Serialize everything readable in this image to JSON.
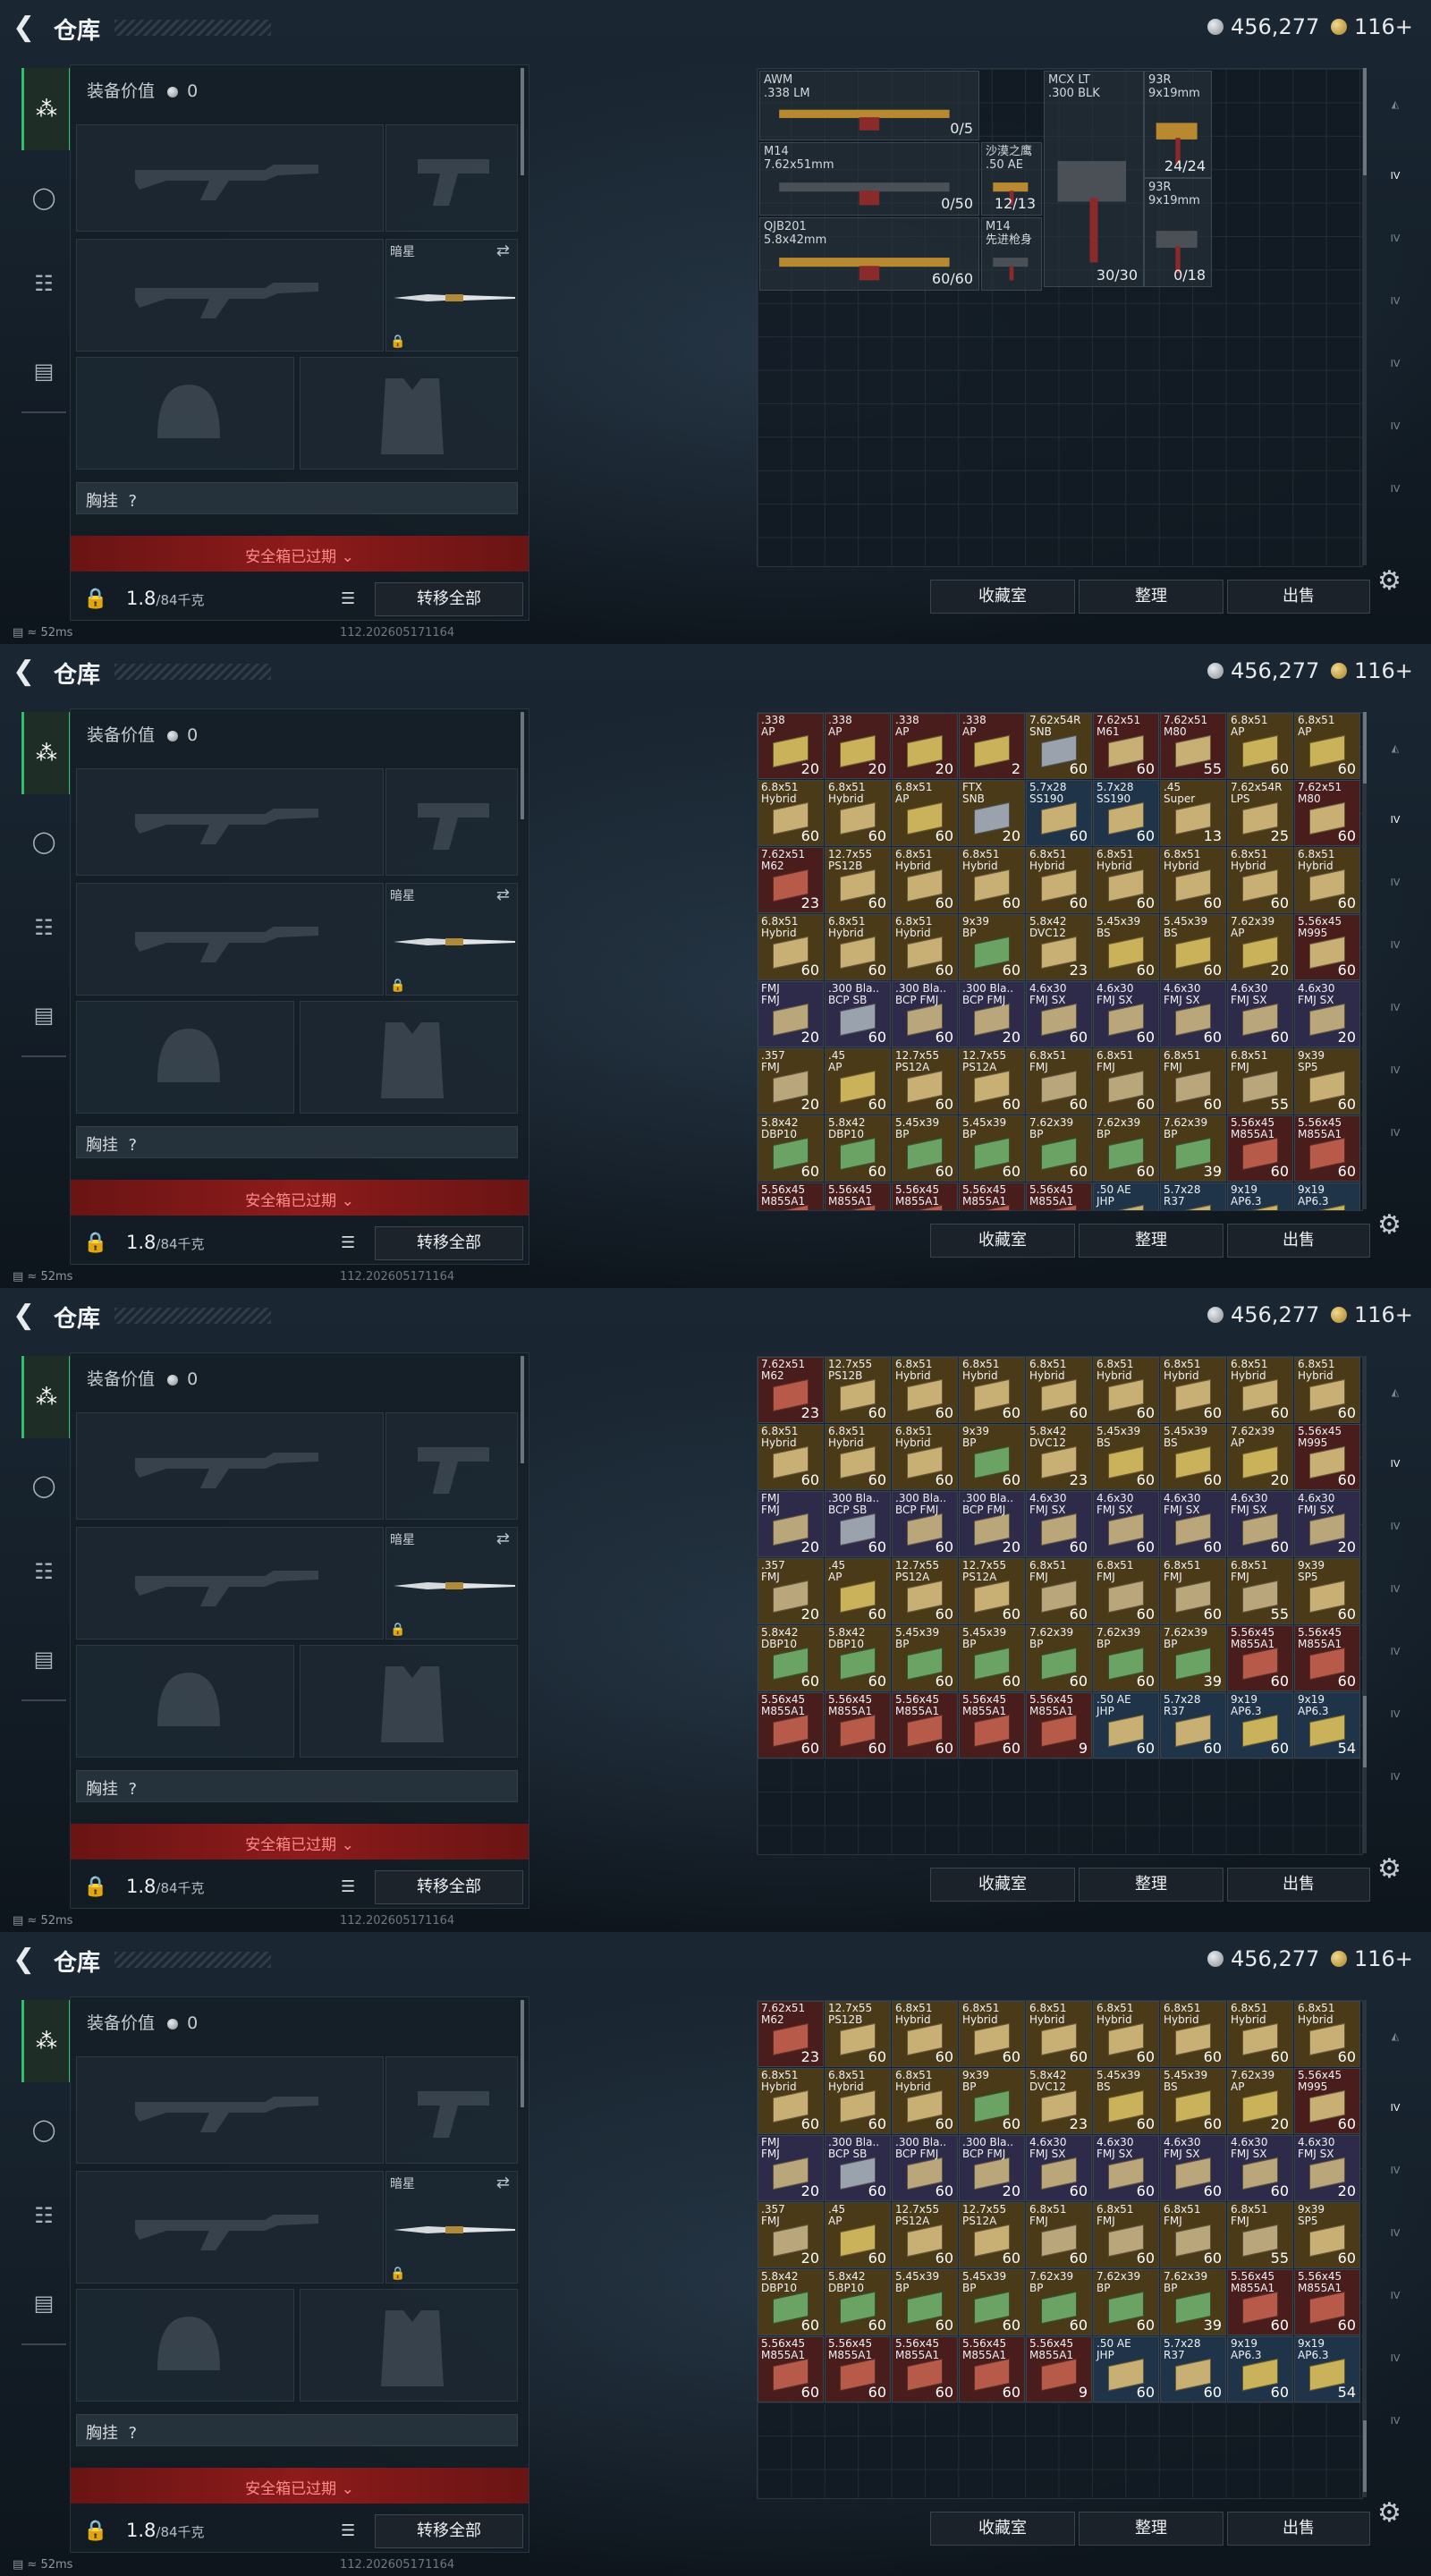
{
  "header": {
    "title": "仓库",
    "silver": "456,277",
    "gold": "116+"
  },
  "equipment": {
    "value_label": "装备价值",
    "value": "0",
    "secondary_label": "暗星",
    "chest_label": "胸挂",
    "chest_question": "?",
    "safe_box_label": "安全箱已过期",
    "weight": "1.8",
    "weight_max": "/84千克",
    "transfer_all": "转移全部"
  },
  "bottom_buttons": {
    "collection": "收藏室",
    "sort": "整理",
    "sell": "出售"
  },
  "status": {
    "ping": "52ms",
    "version": "112.202605171164"
  },
  "weapons": [
    {
      "name": "AWM",
      "caliber": ".338 LM",
      "count": "0/5"
    },
    {
      "name": "MCX LT",
      "caliber": ".300 BLK",
      "count": "30/30"
    },
    {
      "name": "93R",
      "caliber": "9x19mm",
      "count": "24/24"
    },
    {
      "name": "M14",
      "caliber": "7.62x51mm",
      "count": "0/50"
    },
    {
      "name": "沙漠之鹰",
      "caliber": ".50 AE",
      "count": "12/13"
    },
    {
      "name": "93R",
      "caliber": "9x19mm",
      "count": "0/18"
    },
    {
      "name": "QJB201",
      "caliber": "5.8x42mm",
      "count": "60/60"
    },
    {
      "name": "M14",
      "caliber": "先进枪身",
      "count": ""
    }
  ],
  "ammo_rows": [
    [
      [
        ".338\nAP",
        "20"
      ],
      [
        ".338\nAP",
        "20"
      ],
      [
        ".338\nAP",
        "20"
      ],
      [
        ".338\nAP",
        "2"
      ],
      [
        "7.62x54R\nSNB",
        "60"
      ],
      [
        "7.62x51\nM61",
        "60"
      ],
      [
        "7.62x51\nM80",
        "55"
      ],
      [
        "6.8x51\nAP",
        "60"
      ],
      [
        "6.8x51\nAP",
        "60"
      ]
    ],
    [
      [
        "6.8x51\nHybrid",
        "60"
      ],
      [
        "6.8x51\nHybrid",
        "60"
      ],
      [
        "6.8x51\nAP",
        "60"
      ],
      [
        "FTX\nSNB",
        "20"
      ],
      [
        "5.7x28\nSS190",
        "60"
      ],
      [
        "5.7x28\nSS190",
        "60"
      ],
      [
        ".45\nSuper",
        "13"
      ],
      [
        "7.62x54R\nLPS",
        "25"
      ],
      [
        "7.62x51\nM80",
        "60"
      ]
    ],
    [
      [
        "7.62x51\nM62",
        "23"
      ],
      [
        "12.7x55\nPS12B",
        "60"
      ],
      [
        "6.8x51\nHybrid",
        "60"
      ],
      [
        "6.8x51\nHybrid",
        "60"
      ],
      [
        "6.8x51\nHybrid",
        "60"
      ],
      [
        "6.8x51\nHybrid",
        "60"
      ],
      [
        "6.8x51\nHybrid",
        "60"
      ],
      [
        "6.8x51\nHybrid",
        "60"
      ],
      [
        "6.8x51\nHybrid",
        "60"
      ]
    ],
    [
      [
        "6.8x51\nHybrid",
        "60"
      ],
      [
        "6.8x51\nHybrid",
        "60"
      ],
      [
        "6.8x51\nHybrid",
        "60"
      ],
      [
        "9x39\nBP",
        "60"
      ],
      [
        "5.8x42\nDVC12",
        "23"
      ],
      [
        "5.45x39\nBS",
        "60"
      ],
      [
        "5.45x39\nBS",
        "60"
      ],
      [
        "7.62x39\nAP",
        "20"
      ],
      [
        "5.56x45\nM995",
        "60"
      ]
    ],
    [
      [
        "FMJ\nFMJ",
        "20"
      ],
      [
        ".300 Bla..\nBCP SB",
        "60"
      ],
      [
        ".300 Bla..\nBCP FMJ",
        "60"
      ],
      [
        ".300 Bla..\nBCP FMJ",
        "20"
      ],
      [
        "4.6x30\nFMJ SX",
        "60"
      ],
      [
        "4.6x30\nFMJ SX",
        "60"
      ],
      [
        "4.6x30\nFMJ SX",
        "60"
      ],
      [
        "4.6x30\nFMJ SX",
        "60"
      ],
      [
        "4.6x30\nFMJ SX",
        "20"
      ]
    ],
    [
      [
        ".357\nFMJ",
        "20"
      ],
      [
        ".45\nAP",
        "60"
      ],
      [
        "12.7x55\nPS12A",
        "60"
      ],
      [
        "12.7x55\nPS12A",
        "60"
      ],
      [
        "6.8x51\nFMJ",
        "60"
      ],
      [
        "6.8x51\nFMJ",
        "60"
      ],
      [
        "6.8x51\nFMJ",
        "60"
      ],
      [
        "6.8x51\nFMJ",
        "55"
      ],
      [
        "9x39\nSP5",
        "60"
      ]
    ],
    [
      [
        "5.8x42\nDBP10",
        "60"
      ],
      [
        "5.8x42\nDBP10",
        "60"
      ],
      [
        "5.45x39\nBP",
        "60"
      ],
      [
        "5.45x39\nBP",
        "60"
      ],
      [
        "7.62x39\nBP",
        "60"
      ],
      [
        "7.62x39\nBP",
        "60"
      ],
      [
        "7.62x39\nBP",
        "39"
      ],
      [
        "5.56x45\nM855A1",
        "60"
      ],
      [
        "5.56x45\nM855A1",
        "60"
      ]
    ],
    [
      [
        "5.56x45\nM855A1",
        "60"
      ],
      [
        "5.56x45\nM855A1",
        "60"
      ],
      [
        "5.56x45\nM855A1",
        "60"
      ],
      [
        "5.56x45\nM855A1",
        "60"
      ],
      [
        "5.56x45\nM855A1",
        "9"
      ],
      [
        ".50 AE\nJHP",
        "60"
      ],
      [
        "5.7x28\nR37",
        "60"
      ],
      [
        "9x19\nAP6.3",
        "60"
      ],
      [
        "9x19\nAP6.3",
        "54"
      ]
    ]
  ],
  "ammo_palette": {
    "tile_red": "#4a1d1d",
    "tile_gold": "#4b3a17",
    "tile_purple": "#2e2b4a",
    "tile_blue": "#1f3448",
    "tile_gray": "#3a3d42",
    "accent_green": "#2fbf6d",
    "danger_red": "#8d1b1b"
  }
}
